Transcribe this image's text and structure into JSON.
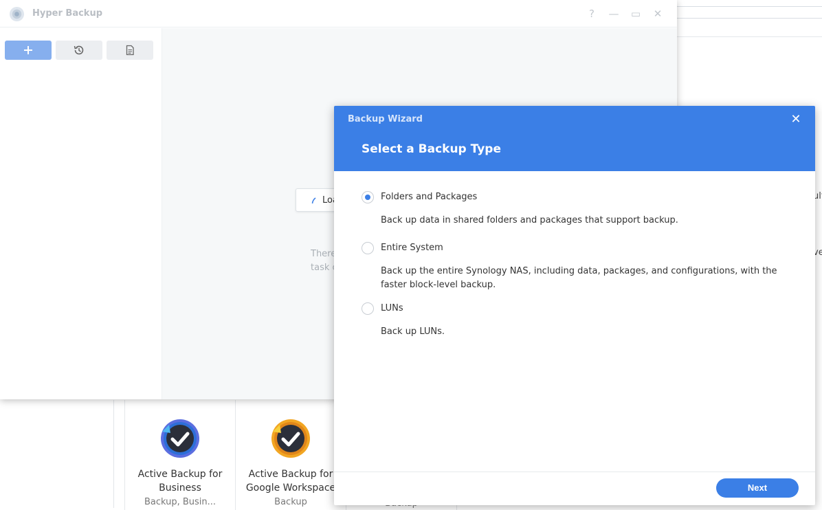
{
  "background": {
    "peek_right_1": "ult",
    "peek_right_2": "ve",
    "tiles": [
      {
        "name_line1": "Active Backup for",
        "name_line2": "Business",
        "category": "Backup, Busin...",
        "accent": "#5b6ee0"
      },
      {
        "name_line1": "Active Backup for",
        "name_line2": "Google Workspace",
        "category": "Backup",
        "accent": "#f2a623"
      },
      {
        "category": "Backup"
      }
    ]
  },
  "hyper_backup": {
    "title": "Hyper Backup",
    "controls": {
      "help": "?",
      "minimize": "—",
      "maximize": "▭",
      "close": "✕"
    },
    "toolbar": {
      "add_icon": "plus-icon",
      "history_icon": "history-icon",
      "log_icon": "log-icon"
    },
    "loading_text": "Loa",
    "empty_text_line1": "There",
    "empty_text_line2": "task c"
  },
  "wizard": {
    "title": "Backup Wizard",
    "close": "✕",
    "subtitle": "Select a Backup Type",
    "options": [
      {
        "label": "Folders and Packages",
        "desc": "Back up data in shared folders and packages that support backup.",
        "selected": true
      },
      {
        "label": "Entire System",
        "desc": "Back up the entire Synology NAS, including data, packages, and configurations, with the faster block-level backup.",
        "selected": false
      },
      {
        "label": "LUNs",
        "desc": "Back up LUNs.",
        "selected": false
      }
    ],
    "next_label": "Next"
  }
}
